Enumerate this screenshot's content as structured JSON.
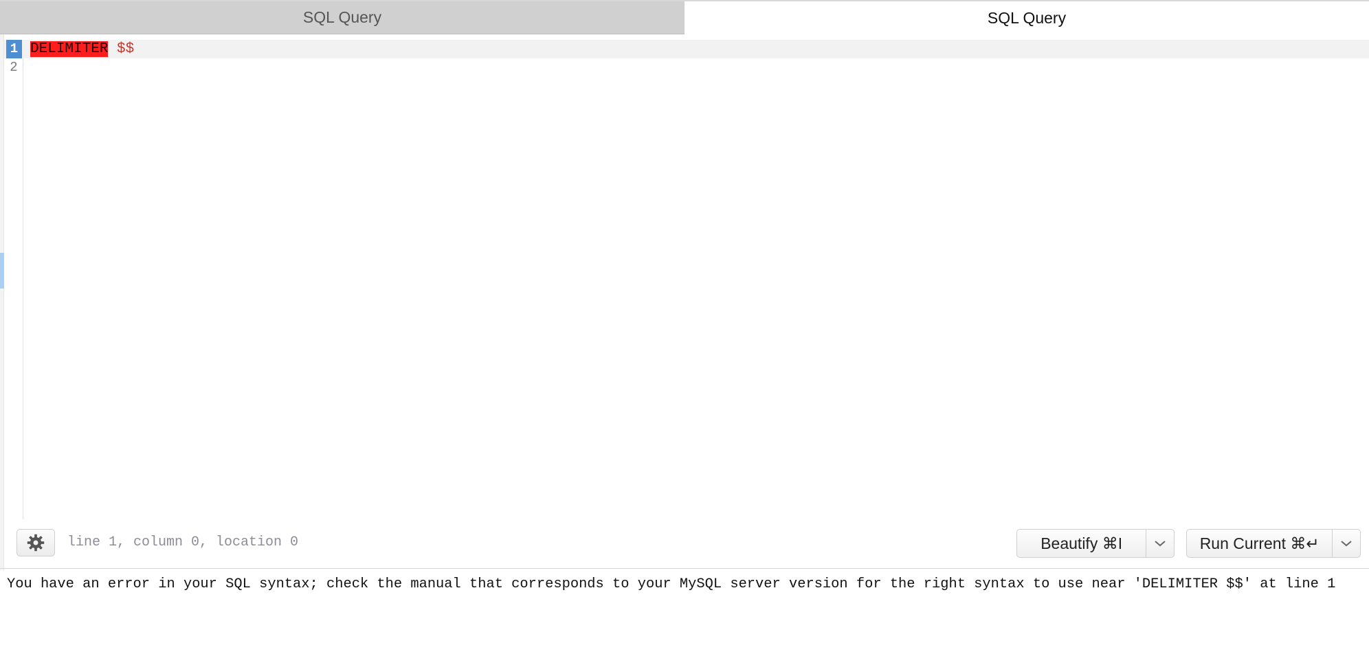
{
  "tabs": [
    {
      "label": "SQL Query",
      "active": false
    },
    {
      "label": "SQL Query",
      "active": true
    }
  ],
  "editor": {
    "line_numbers": [
      "1",
      "2"
    ],
    "current_line": 1,
    "lines": [
      {
        "tokens": [
          {
            "text": "DELIMITER",
            "type": "error-keyword"
          },
          {
            "text": " ",
            "type": "plain"
          },
          {
            "text": "$$",
            "type": "variable"
          }
        ]
      },
      {
        "tokens": []
      }
    ]
  },
  "toolbar": {
    "settings_icon": "gear-icon",
    "status_text": "line 1, column 0, location 0",
    "beautify_label": "Beautify ⌘I",
    "run_label": "Run Current ⌘↵",
    "dropdown_icon": "chevron-down-icon"
  },
  "error_message": "You have an error in your SQL syntax; check the manual that corresponds to your MySQL server version for the right syntax to use near 'DELIMITER $$' at line 1",
  "colors": {
    "error_highlight": "#ff1d1d",
    "variable_token": "#c0392b",
    "current_line_number_bg": "#4d8fd0",
    "inactive_tab_bg": "#d0d0d0"
  }
}
